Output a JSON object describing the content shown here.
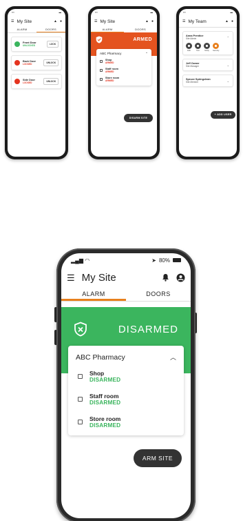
{
  "phone_small_1": {
    "title": "My Site",
    "tabs": [
      "ALARM",
      "DOORS"
    ],
    "doors": [
      {
        "name": "Front Door",
        "status": "UNLOCKED",
        "status_color": "#3bb55e",
        "dot_color": "#3bb55e",
        "action": "LOCK"
      },
      {
        "name": "Back Door",
        "status": "LOCKED",
        "status_color": "#e4331f",
        "dot_color": "#e4331f",
        "action": "UNLOCK"
      },
      {
        "name": "Side Door",
        "status": "LOCKED",
        "status_color": "#e4331f",
        "dot_color": "#e4331f",
        "action": "UNLOCK"
      }
    ]
  },
  "phone_small_2": {
    "title": "My Site",
    "tabs": [
      "ALARM",
      "DOORS"
    ],
    "state": "ARMED",
    "panel_title": "ABC Pharmacy",
    "rooms": [
      {
        "name": "Shop",
        "status": "ARMED"
      },
      {
        "name": "Staff room",
        "status": "ARMED"
      },
      {
        "name": "Store room",
        "status": "ARMED"
      }
    ],
    "action": "DISARM SITE"
  },
  "phone_small_3": {
    "title": "My Team",
    "members": [
      {
        "name": "Anna Prentice",
        "role": "Site Admin",
        "actions": [
          "Edit",
          "Text",
          "Notify",
          "Security"
        ]
      },
      {
        "name": "Jeff Owner",
        "role": "Site Manager"
      },
      {
        "name": "Spruce Springclean",
        "role": "Site Member"
      }
    ],
    "action": "+ ADD USER"
  },
  "phone_big": {
    "battery": "80%",
    "title": "My Site",
    "tabs": [
      "ALARM",
      "DOORS"
    ],
    "state": "DISARMED",
    "panel_title": "ABC Pharmacy",
    "rooms": [
      {
        "name": "Shop",
        "status": "DISARMED"
      },
      {
        "name": "Staff room",
        "status": "DISARMED"
      },
      {
        "name": "Store room",
        "status": "DISARMED"
      }
    ],
    "action": "ARM SITE"
  },
  "colors": {
    "accent_orange": "#e8801e",
    "armed_red": "#e4531f",
    "disarmed_green": "#3bb55e",
    "pill_dark": "#333333"
  },
  "icons": [
    "menu-icon",
    "bell-icon",
    "account-icon",
    "shield-icon",
    "chevron-up-icon",
    "wifi-icon",
    "signal-icon",
    "battery-icon"
  ]
}
